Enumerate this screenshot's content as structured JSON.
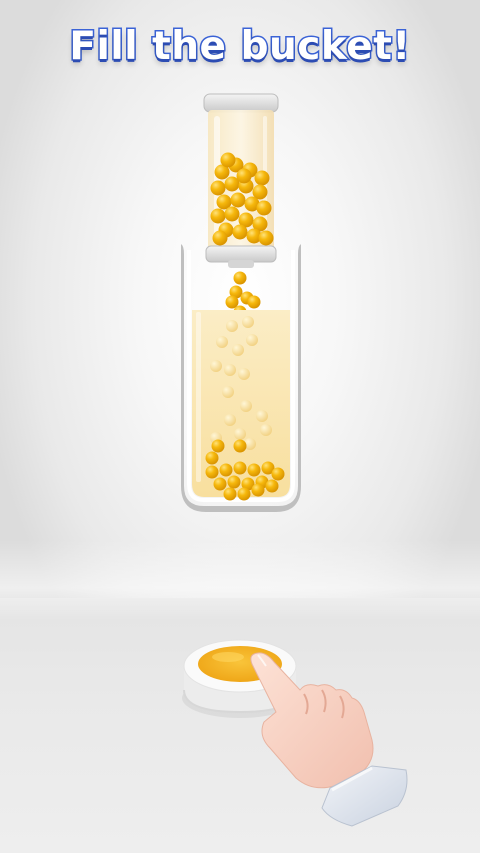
{
  "instruction": "Fill the bucket!",
  "colors": {
    "ball": "#f5b400",
    "ball_highlight": "#ffe066",
    "liquid": "#fbe7b0",
    "button_top": "#f4b324",
    "title_fill": "#ffffff",
    "title_stroke": "#3b63d6"
  },
  "icons": {
    "dispenser": "dispenser-tube-icon",
    "bucket": "bucket-glass-icon",
    "button": "press-button-icon",
    "hand": "pointing-hand-icon"
  }
}
